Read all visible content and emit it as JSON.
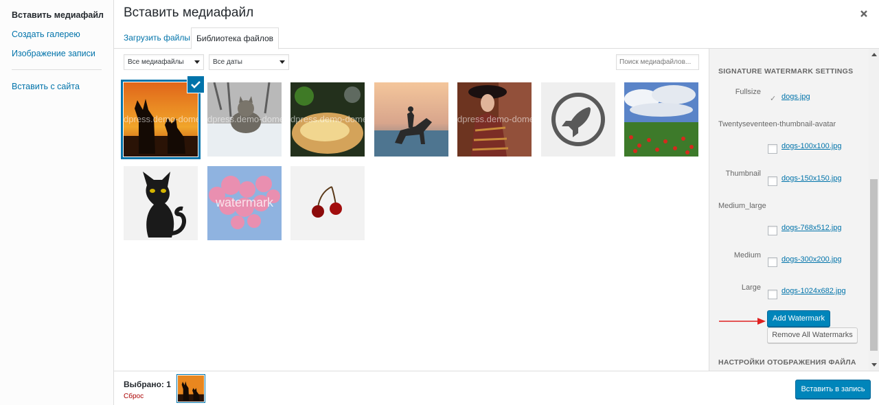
{
  "menu": {
    "items": [
      {
        "label": "Вставить медиафайл"
      },
      {
        "label": "Создать галерею"
      },
      {
        "label": "Изображение записи"
      },
      {
        "label": "Вставить с сайта"
      }
    ]
  },
  "frame": {
    "title": "Вставить медиафайл"
  },
  "router": {
    "tabs": [
      {
        "label": "Загрузить файлы"
      },
      {
        "label": "Библиотека файлов"
      }
    ]
  },
  "toolbar": {
    "filter_type": "Все медиафайлы",
    "filter_date": "Все даты",
    "search_placeholder": "Поиск медиафайлов..."
  },
  "attachments": {
    "watermark_text": "dpress.demo-dome",
    "watermark_big": "watermark"
  },
  "sidebar": {
    "heading": "SIGNATURE WATERMARK SETTINGS",
    "sizes": [
      {
        "label": "Fullsize",
        "file": "dogs.jpg",
        "checked": true
      },
      {
        "label": "Twentyseventeen-thumbnail-avatar",
        "file": "dogs-100x100.jpg",
        "checked": false
      },
      {
        "label": "Thumbnail",
        "file": "dogs-150x150.jpg",
        "checked": false
      },
      {
        "label": "Medium_large",
        "file": "dogs-768x512.jpg",
        "checked": false
      },
      {
        "label": "Medium",
        "file": "dogs-300x200.jpg",
        "checked": false
      },
      {
        "label": "Large",
        "file": "dogs-1024x682.jpg",
        "checked": false
      }
    ],
    "add_button": "Add Watermark",
    "remove_button": "Remove All Watermarks",
    "display_heading": "НАСТРОЙКИ ОТОБРАЖЕНИЯ ФАЙЛА"
  },
  "footer": {
    "selected": "Выбрано: 1",
    "reset": "Сброс",
    "insert_button": "Вставить в запись"
  },
  "colors": {
    "accent": "#0073aa",
    "button": "#0085ba",
    "danger": "#a00",
    "arrow": "#e02020"
  }
}
